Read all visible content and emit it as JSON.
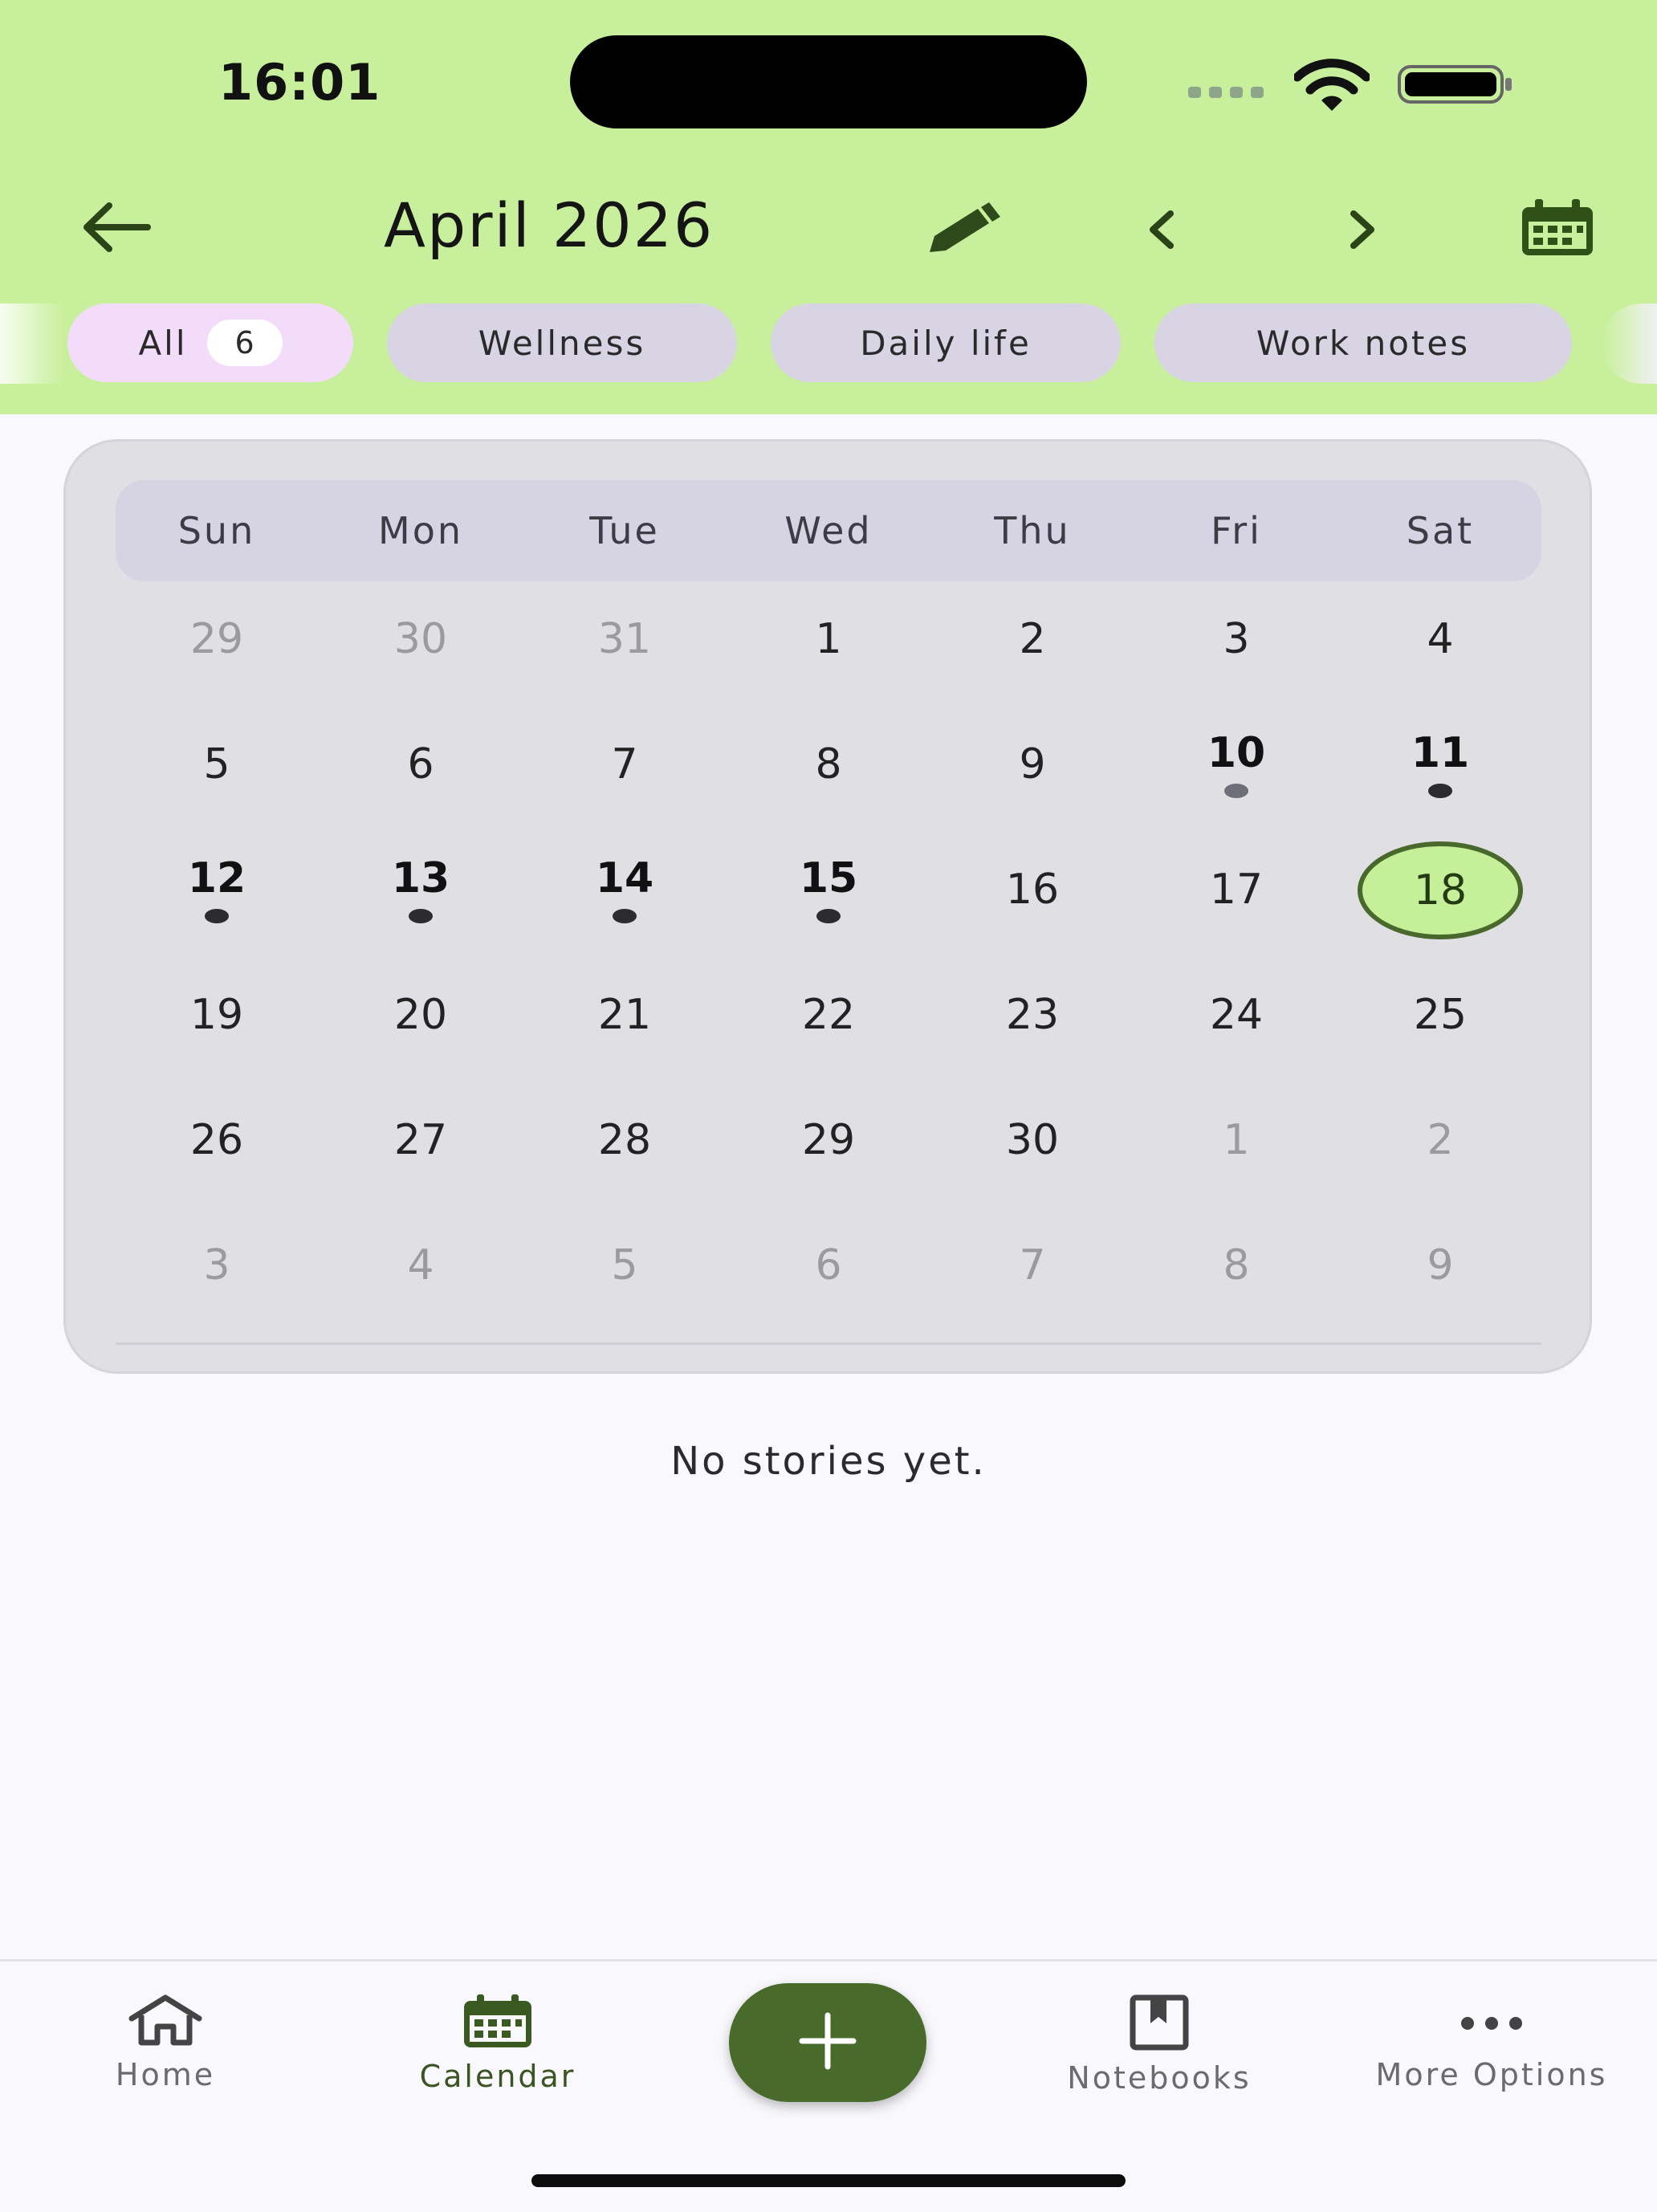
{
  "status_bar": {
    "time": "16:01"
  },
  "header": {
    "title": "April 2026",
    "icons": {
      "back": "arrow-left-icon",
      "edit": "pencil-icon",
      "prev": "chevron-left-icon",
      "next": "chevron-right-icon",
      "calendar": "calendar-icon"
    },
    "background": "#c8f09c"
  },
  "filters": [
    {
      "label": "All",
      "count": "6",
      "active": true
    },
    {
      "label": "Wellness",
      "active": false
    },
    {
      "label": "Daily life",
      "active": false
    },
    {
      "label": "Work notes",
      "active": false
    }
  ],
  "calendar": {
    "weekdays": [
      "Sun",
      "Mon",
      "Tue",
      "Wed",
      "Thu",
      "Fri",
      "Sat"
    ],
    "weeks": [
      [
        {
          "d": "29",
          "muted": true
        },
        {
          "d": "30",
          "muted": true
        },
        {
          "d": "31",
          "muted": true
        },
        {
          "d": "1"
        },
        {
          "d": "2"
        },
        {
          "d": "3"
        },
        {
          "d": "4"
        }
      ],
      [
        {
          "d": "5"
        },
        {
          "d": "6"
        },
        {
          "d": "7"
        },
        {
          "d": "8"
        },
        {
          "d": "9"
        },
        {
          "d": "10",
          "entry": true,
          "dot": "light"
        },
        {
          "d": "11",
          "entry": true,
          "dot": "dark"
        }
      ],
      [
        {
          "d": "12",
          "entry": true,
          "dot": "dark"
        },
        {
          "d": "13",
          "entry": true,
          "dot": "dark"
        },
        {
          "d": "14",
          "entry": true,
          "dot": "dark"
        },
        {
          "d": "15",
          "entry": true,
          "dot": "dark"
        },
        {
          "d": "16"
        },
        {
          "d": "17"
        },
        {
          "d": "18",
          "selected": true
        }
      ],
      [
        {
          "d": "19"
        },
        {
          "d": "20"
        },
        {
          "d": "21"
        },
        {
          "d": "22"
        },
        {
          "d": "23"
        },
        {
          "d": "24"
        },
        {
          "d": "25"
        }
      ],
      [
        {
          "d": "26"
        },
        {
          "d": "27"
        },
        {
          "d": "28"
        },
        {
          "d": "29"
        },
        {
          "d": "30"
        },
        {
          "d": "1",
          "muted": true
        },
        {
          "d": "2",
          "muted": true
        }
      ],
      [
        {
          "d": "3",
          "muted": true
        },
        {
          "d": "4",
          "muted": true
        },
        {
          "d": "5",
          "muted": true
        },
        {
          "d": "6",
          "muted": true
        },
        {
          "d": "7",
          "muted": true
        },
        {
          "d": "8",
          "muted": true
        },
        {
          "d": "9",
          "muted": true
        }
      ]
    ],
    "selected_color": "#c6ef9a",
    "selected_border": "#49682c"
  },
  "empty_state": "No stories yet.",
  "bottom_nav": {
    "items": [
      {
        "label": "Home",
        "icon": "home-icon",
        "active": false
      },
      {
        "label": "Calendar",
        "icon": "calendar-icon",
        "active": true
      },
      {
        "label": "Notebooks",
        "icon": "notebook-icon",
        "active": false
      },
      {
        "label": "More Options",
        "icon": "more-icon",
        "active": false
      }
    ],
    "fab_icon": "plus-icon",
    "accent": "#486b2b"
  }
}
